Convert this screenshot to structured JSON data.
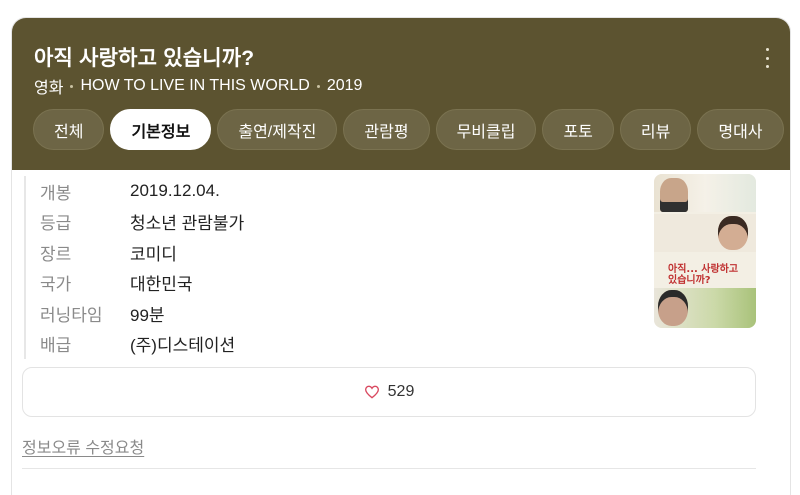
{
  "header": {
    "title": "아직 사랑하고 있습니까?",
    "subtitle": {
      "category": "영화",
      "english_title": "HOW TO LIVE IN THIS WORLD",
      "year": "2019"
    },
    "background_color": "#5c5330",
    "more_icon": "kebab-vertical-icon"
  },
  "tabs": [
    {
      "label": "전체",
      "active": false
    },
    {
      "label": "기본정보",
      "active": true
    },
    {
      "label": "출연/제작진",
      "active": false
    },
    {
      "label": "관람평",
      "active": false
    },
    {
      "label": "무비클립",
      "active": false
    },
    {
      "label": "포토",
      "active": false
    },
    {
      "label": "리뷰",
      "active": false
    },
    {
      "label": "명대사",
      "active": false
    }
  ],
  "info": [
    {
      "key": "개봉",
      "value": "2019.12.04."
    },
    {
      "key": "등급",
      "value": "청소년 관람불가"
    },
    {
      "key": "장르",
      "value": "코미디"
    },
    {
      "key": "국가",
      "value": "대한민국"
    },
    {
      "key": "러닝타임",
      "value": "99분"
    },
    {
      "key": "배급",
      "value": "(주)디스테이션"
    }
  ],
  "poster": {
    "title_text": "아직... 사랑하고 있습니까?"
  },
  "likes": {
    "icon": "heart-outline-icon",
    "count": "529",
    "icon_color": "#d9485f"
  },
  "report_link": "정보오류 수정요청"
}
